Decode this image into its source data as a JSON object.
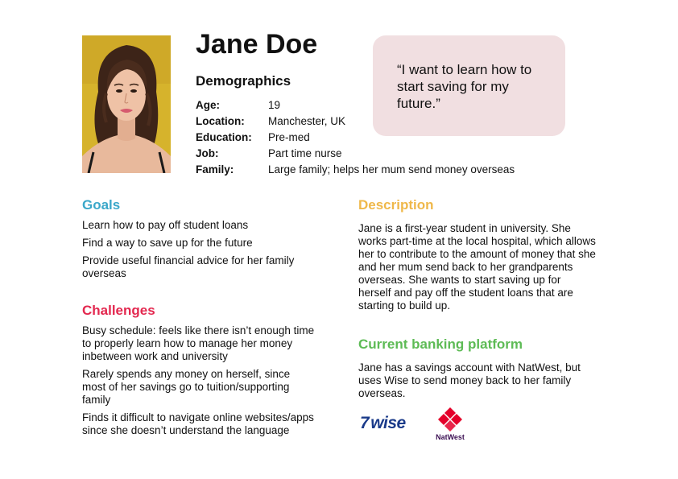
{
  "persona": {
    "name": "Jane Doe",
    "quote": "“I want to learn how to start saving for my future.”"
  },
  "demographics": {
    "title": "Demographics",
    "rows": [
      {
        "label": "Age:",
        "value": "19"
      },
      {
        "label": "Location:",
        "value": "Manchester, UK"
      },
      {
        "label": "Education:",
        "value": "Pre-med"
      },
      {
        "label": "Job:",
        "value": "Part time nurse"
      },
      {
        "label": "Family:",
        "value": "Large family; helps her mum send money overseas"
      }
    ]
  },
  "goals": {
    "title": "Goals",
    "items": [
      "Learn how to pay off student loans",
      "Find a way to save up for the future",
      "Provide useful financial advice for her family overseas"
    ]
  },
  "challenges": {
    "title": "Challenges",
    "items": [
      "Busy schedule: feels like there isn’t enough time to properly learn how to manage her money inbetween work and university",
      "Rarely spends any money on herself, since most of her savings go to tuition/supporting family",
      "Finds it difficult to navigate online websites/apps since she doesn’t understand the language"
    ]
  },
  "description": {
    "title": "Description",
    "text": "Jane is a first-year student in university. She works part-time at the local hospital, which allows her to contribute to the amount of money that she and her mum send back to her grandparents overseas. She wants to start saving up for herself and pay off the student loans that are starting to build up."
  },
  "banking": {
    "title": "Current banking platform",
    "text": "Jane has a savings account with NatWest, but uses Wise to send money back to her family overseas.",
    "logos": {
      "wise": "wise",
      "wise_icon": "7",
      "natwest": "NatWest"
    }
  },
  "colors": {
    "goals": "#3aa7c9",
    "challenges": "#e3284f",
    "description": "#efb84a",
    "banking": "#5dbb55",
    "quote_bg": "#f1dfe1"
  }
}
